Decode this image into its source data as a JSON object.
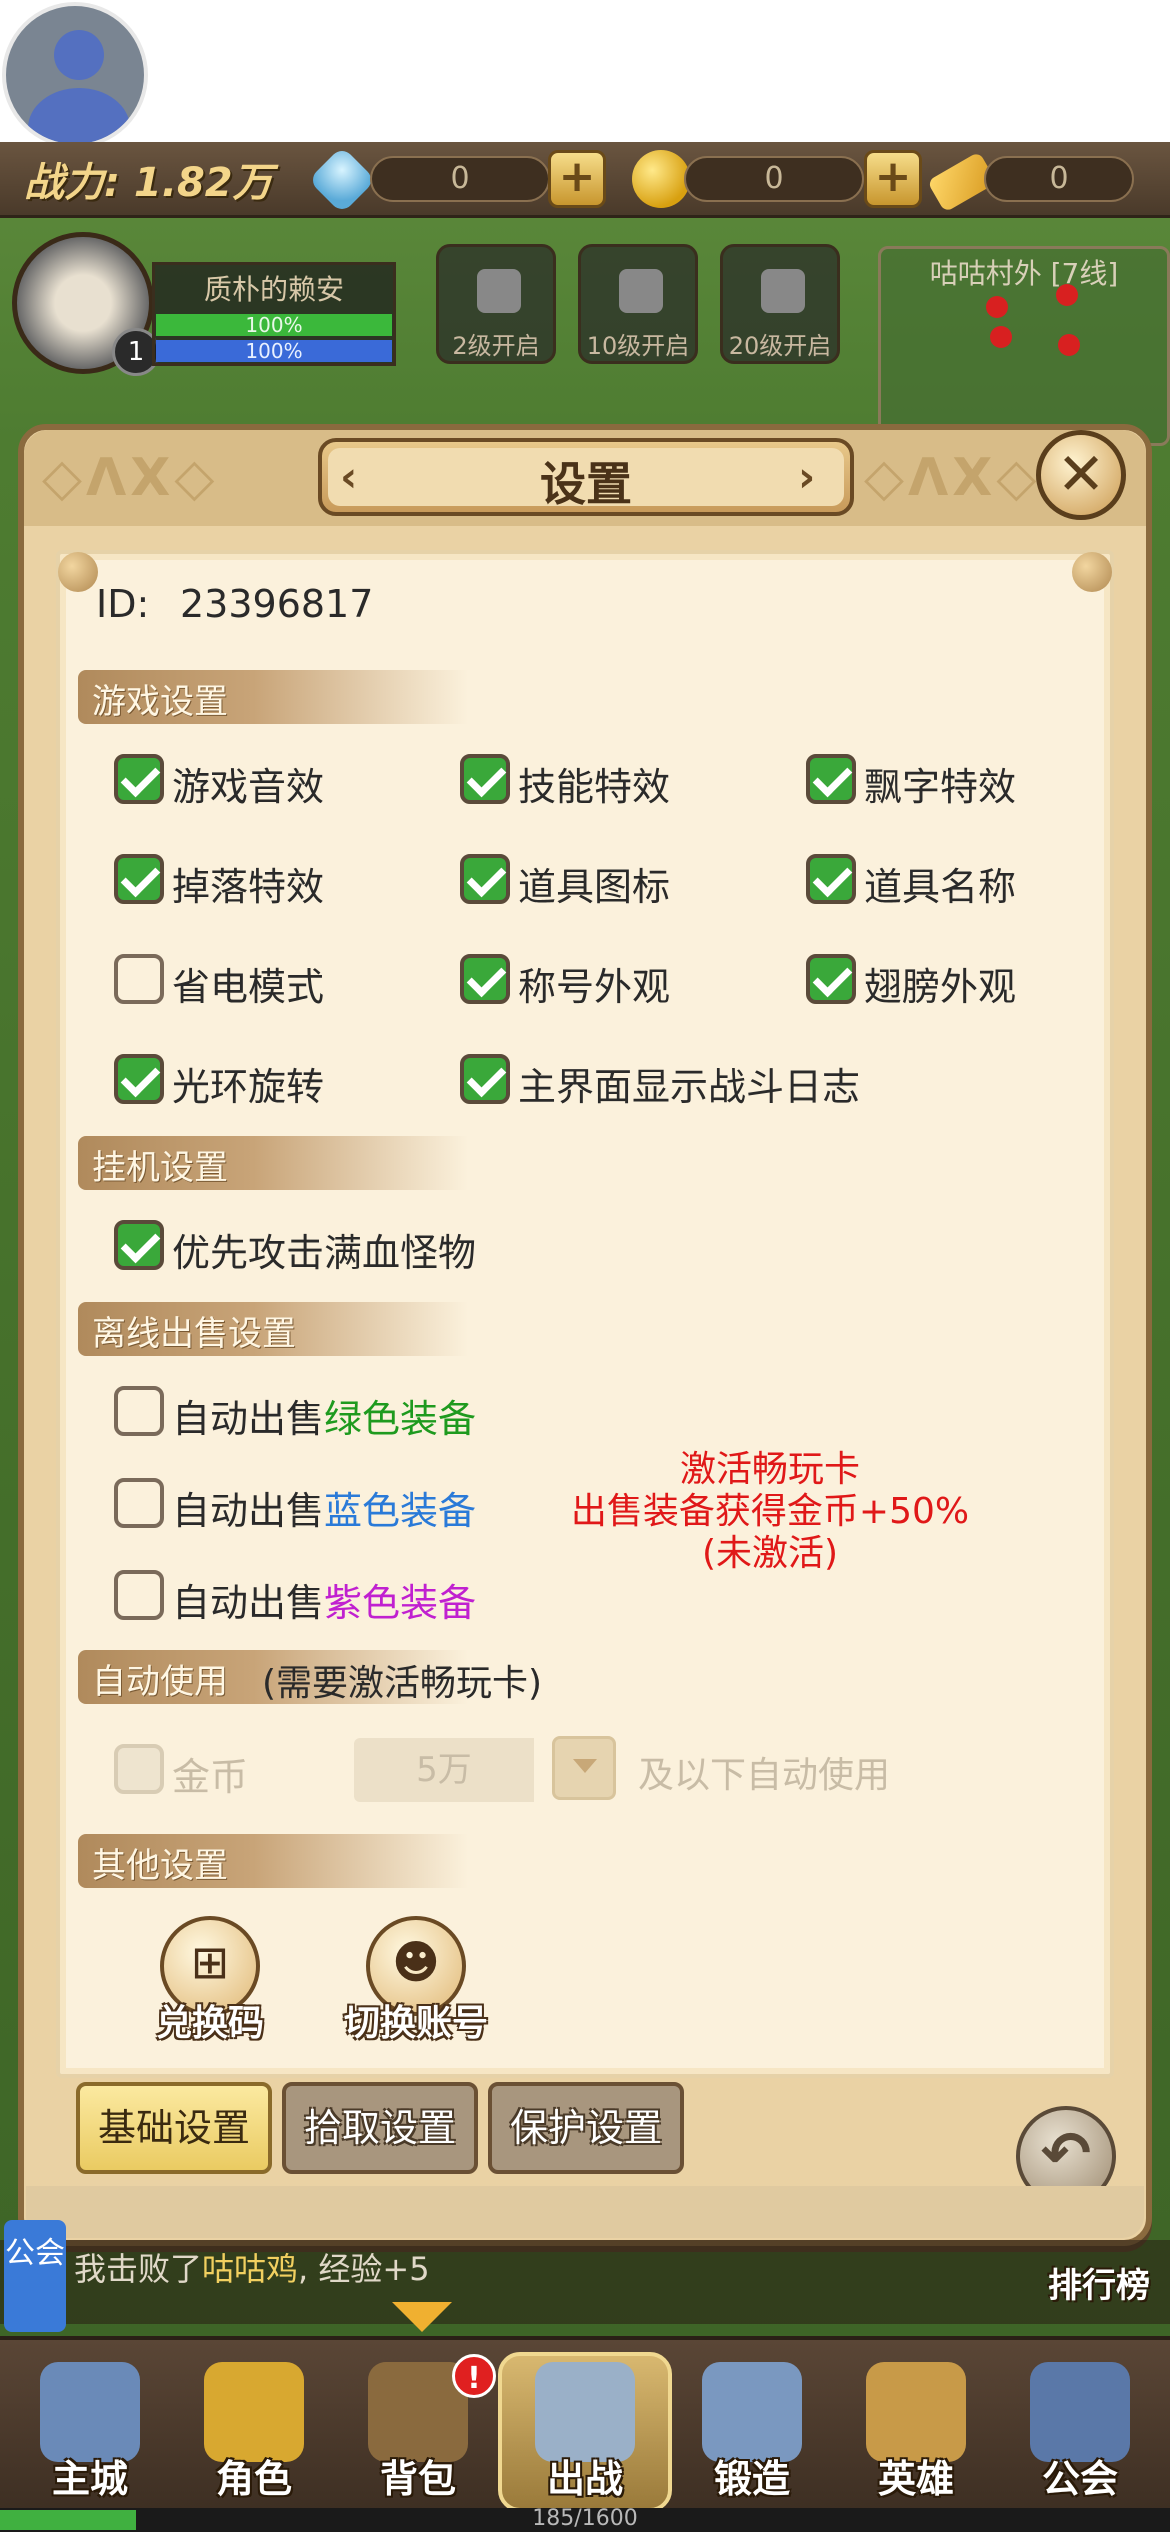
{
  "hud": {
    "power_label": "战力: 1.82万",
    "gems": "0",
    "gold": "0",
    "tickets": "0",
    "hero_name": "质朴的赖安",
    "hero_level": "1",
    "hp_text": "100%",
    "mp_text": "100%",
    "locked_slots": [
      "2级开启",
      "10级开启",
      "20级开启"
    ],
    "map_name": "咕咕村外 [7线]"
  },
  "dialog": {
    "title": "设置",
    "id_label": "ID:",
    "id_value": "23396817",
    "sections": {
      "game": "游戏设置",
      "idle": "挂机设置",
      "offline": "离线出售设置",
      "auto_use": "自动使用",
      "other": "其他设置"
    },
    "auto_use_note": "(需要激活畅玩卡)",
    "game_options": [
      {
        "label": "游戏音效",
        "checked": true
      },
      {
        "label": "技能特效",
        "checked": true
      },
      {
        "label": "飘字特效",
        "checked": true
      },
      {
        "label": "掉落特效",
        "checked": true
      },
      {
        "label": "道具图标",
        "checked": true
      },
      {
        "label": "道具名称",
        "checked": true
      },
      {
        "label": "省电模式",
        "checked": false
      },
      {
        "label": "称号外观",
        "checked": true
      },
      {
        "label": "翅膀外观",
        "checked": true
      },
      {
        "label": "光环旋转",
        "checked": true
      },
      {
        "label": "主界面显示战斗日志",
        "checked": true
      }
    ],
    "idle_option": {
      "label": "优先攻击满血怪物",
      "checked": true
    },
    "offline_options": {
      "prefix": "自动出售",
      "green": "绿色装备",
      "blue": "蓝色装备",
      "purple": "紫色装备"
    },
    "promo": {
      "line1": "激活畅玩卡",
      "line2": "出售装备获得金币+50%",
      "line3": "(未激活)"
    },
    "auto_use": {
      "item_label": "金币",
      "amount": "5万",
      "suffix": "及以下自动使用"
    },
    "other_buttons": {
      "redeem": "兑换码",
      "switch_account": "切换账号"
    },
    "tabs": [
      "基础设置",
      "拾取设置",
      "保护设置"
    ]
  },
  "chat": {
    "tag": "公会",
    "text_prefix": "我击败了",
    "text_highlight": "咕咕鸡",
    "text_suffix": ", 经验+5"
  },
  "rank_label": "排行榜",
  "nav": {
    "items": [
      "主城",
      "角色",
      "背包",
      "出战",
      "锻造",
      "英雄",
      "公会"
    ],
    "badge": "!",
    "exp_text": "185/1600",
    "exp_fraction": 0.116
  },
  "colors": {
    "checked": "#3aa83a",
    "green_equip": "#1e9a1e",
    "blue_equip": "#2a7ad8",
    "purple_equip": "#c020d0",
    "promo": "#e01818"
  }
}
